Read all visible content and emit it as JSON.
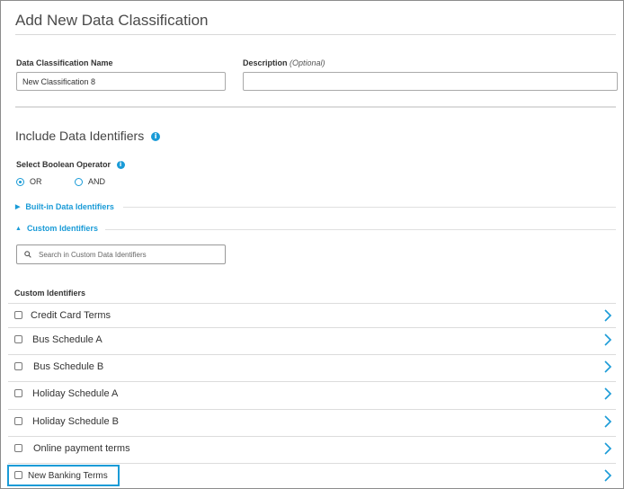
{
  "header": {
    "title": "Add New Data Classification"
  },
  "form": {
    "name_label": "Data Classification Name",
    "name_value": "New Classification 8",
    "description_label": "Description",
    "description_optional": "(Optional)",
    "description_value": ""
  },
  "identifiers": {
    "section_title": "Include Data Identifiers",
    "boolean_label": "Select Boolean Operator",
    "operators": [
      {
        "label": "OR",
        "selected": true
      },
      {
        "label": "AND",
        "selected": false
      }
    ],
    "builtin_label": "Built-in Data Identifiers",
    "custom_label": "Custom Identifiers",
    "search_placeholder": "Search in Custom Data Identifiers"
  },
  "custom_list": {
    "heading": "Custom Identifiers",
    "items": [
      {
        "label": "Credit Card Terms",
        "checked": false
      },
      {
        "label": "Bus Schedule A",
        "checked": false
      },
      {
        "label": "Bus Schedule B",
        "checked": false
      },
      {
        "label": "Holiday Schedule A",
        "checked": false
      },
      {
        "label": "Holiday Schedule B",
        "checked": false
      },
      {
        "label": "Online payment terms",
        "checked": false
      },
      {
        "label": "New Banking Terms",
        "checked": false
      }
    ]
  },
  "icons": {
    "info": "info-icon",
    "search": "search-icon",
    "chevron": "chevron-right-icon",
    "expand": "triangle-right-icon",
    "collapse": "triangle-up-icon"
  },
  "colors": {
    "accent": "#1a9bd7",
    "border": "#8c8c8c",
    "divider": "#dcdcdc"
  }
}
